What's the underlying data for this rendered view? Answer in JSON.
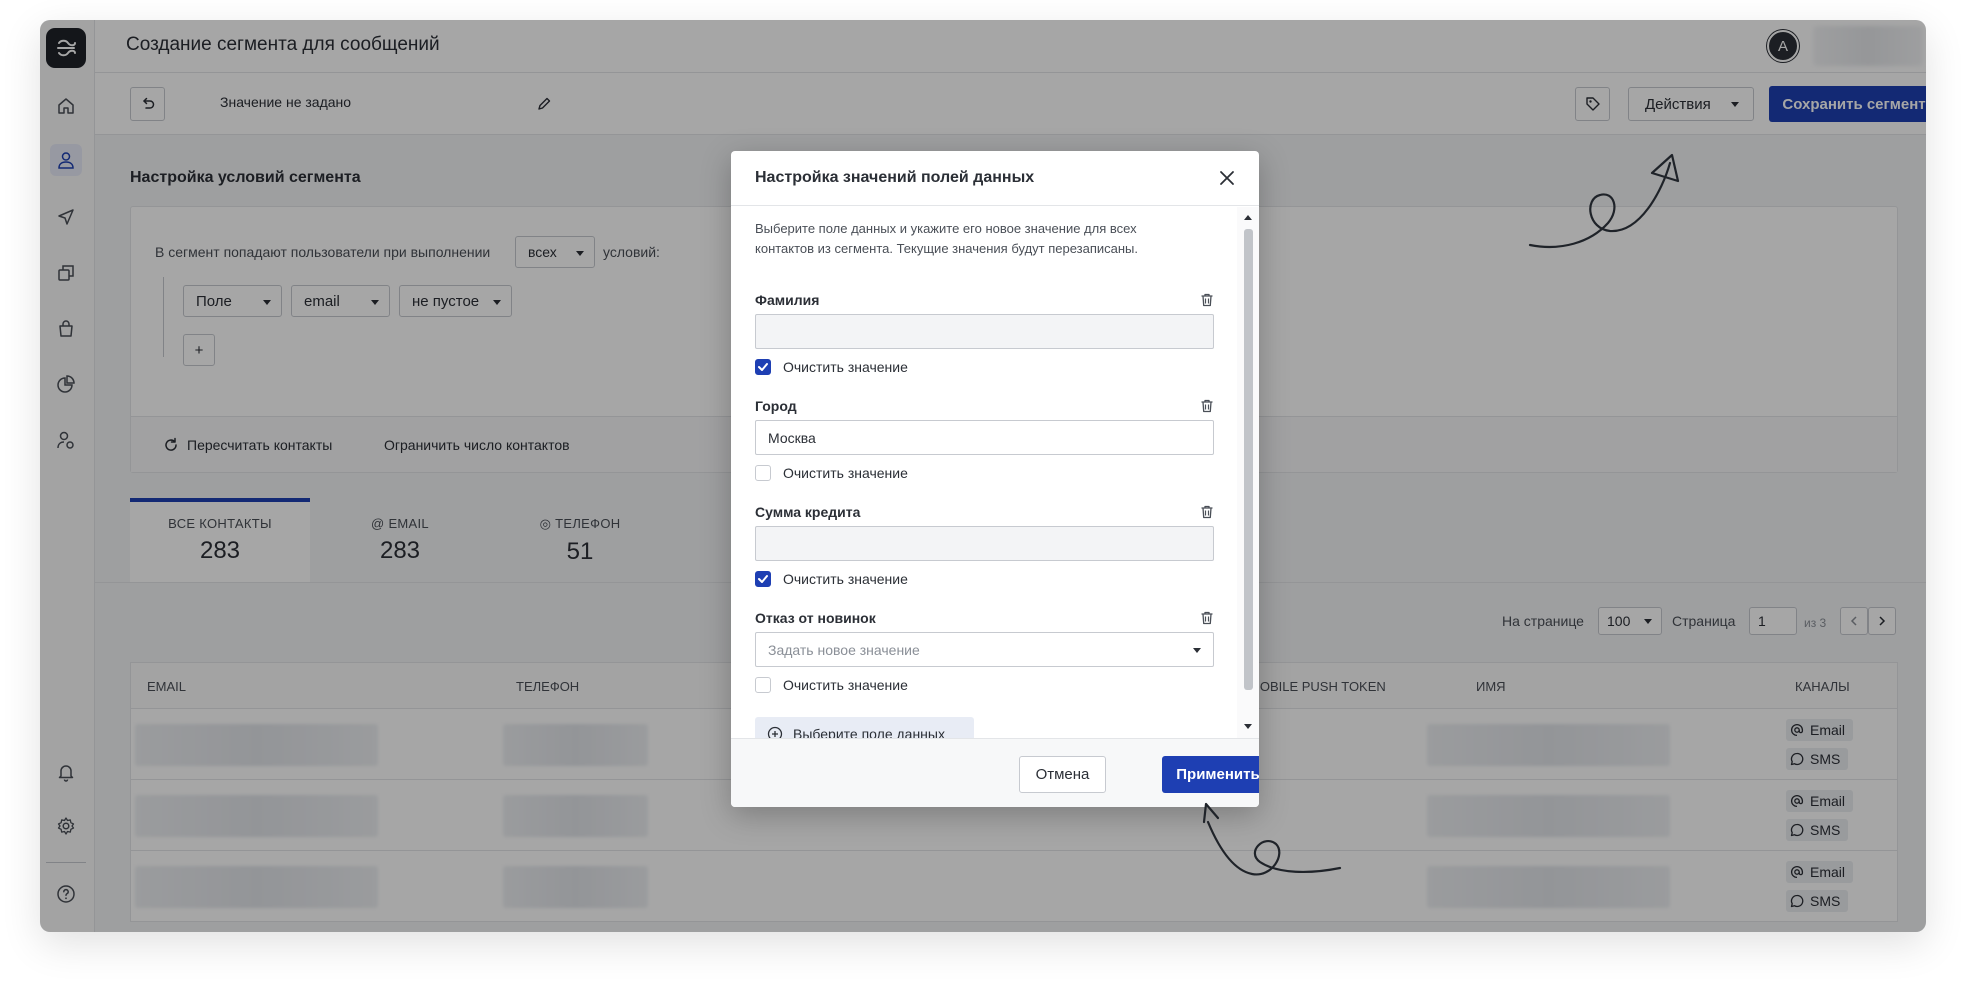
{
  "header": {
    "title": "Создание сегмента для сообщений",
    "avatar_initial": "A"
  },
  "toolbar": {
    "segment_name": "Значение не задано",
    "actions_label": "Действия",
    "save_label": "Сохранить сегмент"
  },
  "conditions": {
    "title": "Настройка условий сегмента",
    "intro_text": "В сегмент попадают пользователи при выполнении",
    "match_value": "всех",
    "suffix_text": "условий:",
    "rule": {
      "field_type": "Поле",
      "field": "email",
      "operator": "не пустое"
    },
    "add_label": "+",
    "recalc_label": "Пересчитать контакты",
    "limit_label": "Ограничить число контактов"
  },
  "tabs": [
    {
      "label": "ВСЕ КОНТАКТЫ",
      "count": "283"
    },
    {
      "label": "EMAIL",
      "count": "283"
    },
    {
      "label": "ТЕЛЕФОН",
      "count": "51"
    }
  ],
  "pager": {
    "per_page_label": "На странице",
    "per_page_value": "100",
    "page_label": "Страница",
    "page_value": "1",
    "of_text": "из 3"
  },
  "table": {
    "columns": [
      "EMAIL",
      "ТЕЛЕФОН",
      "MOBILE PUSH TOKEN",
      "ИМЯ",
      "КАНАЛЫ"
    ],
    "channels": [
      "Email",
      "SMS"
    ]
  },
  "modal": {
    "title": "Настройка значений полей данных",
    "description": "Выберите поле данных и укажите его новое значение для всех контактов из сегмента. Текущие значения будут перезаписаны.",
    "fields": [
      {
        "label": "Фамилия",
        "value": "",
        "clear_label": "Очистить значение",
        "clear_checked": true
      },
      {
        "label": "Город",
        "value": "Москва",
        "clear_label": "Очистить значение",
        "clear_checked": false
      },
      {
        "label": "Сумма кредита",
        "value": "",
        "clear_label": "Очистить значение",
        "clear_checked": true
      },
      {
        "label": "Отказ от новинок",
        "placeholder": "Задать новое значение",
        "clear_label": "Очистить значение",
        "clear_checked": false
      }
    ],
    "add_field_label": "Выберите поле данных",
    "cancel_label": "Отмена",
    "apply_label": "Применить"
  },
  "colors": {
    "primary": "#1e3fb3",
    "overlay": "rgba(0,0,0,0.35)"
  }
}
